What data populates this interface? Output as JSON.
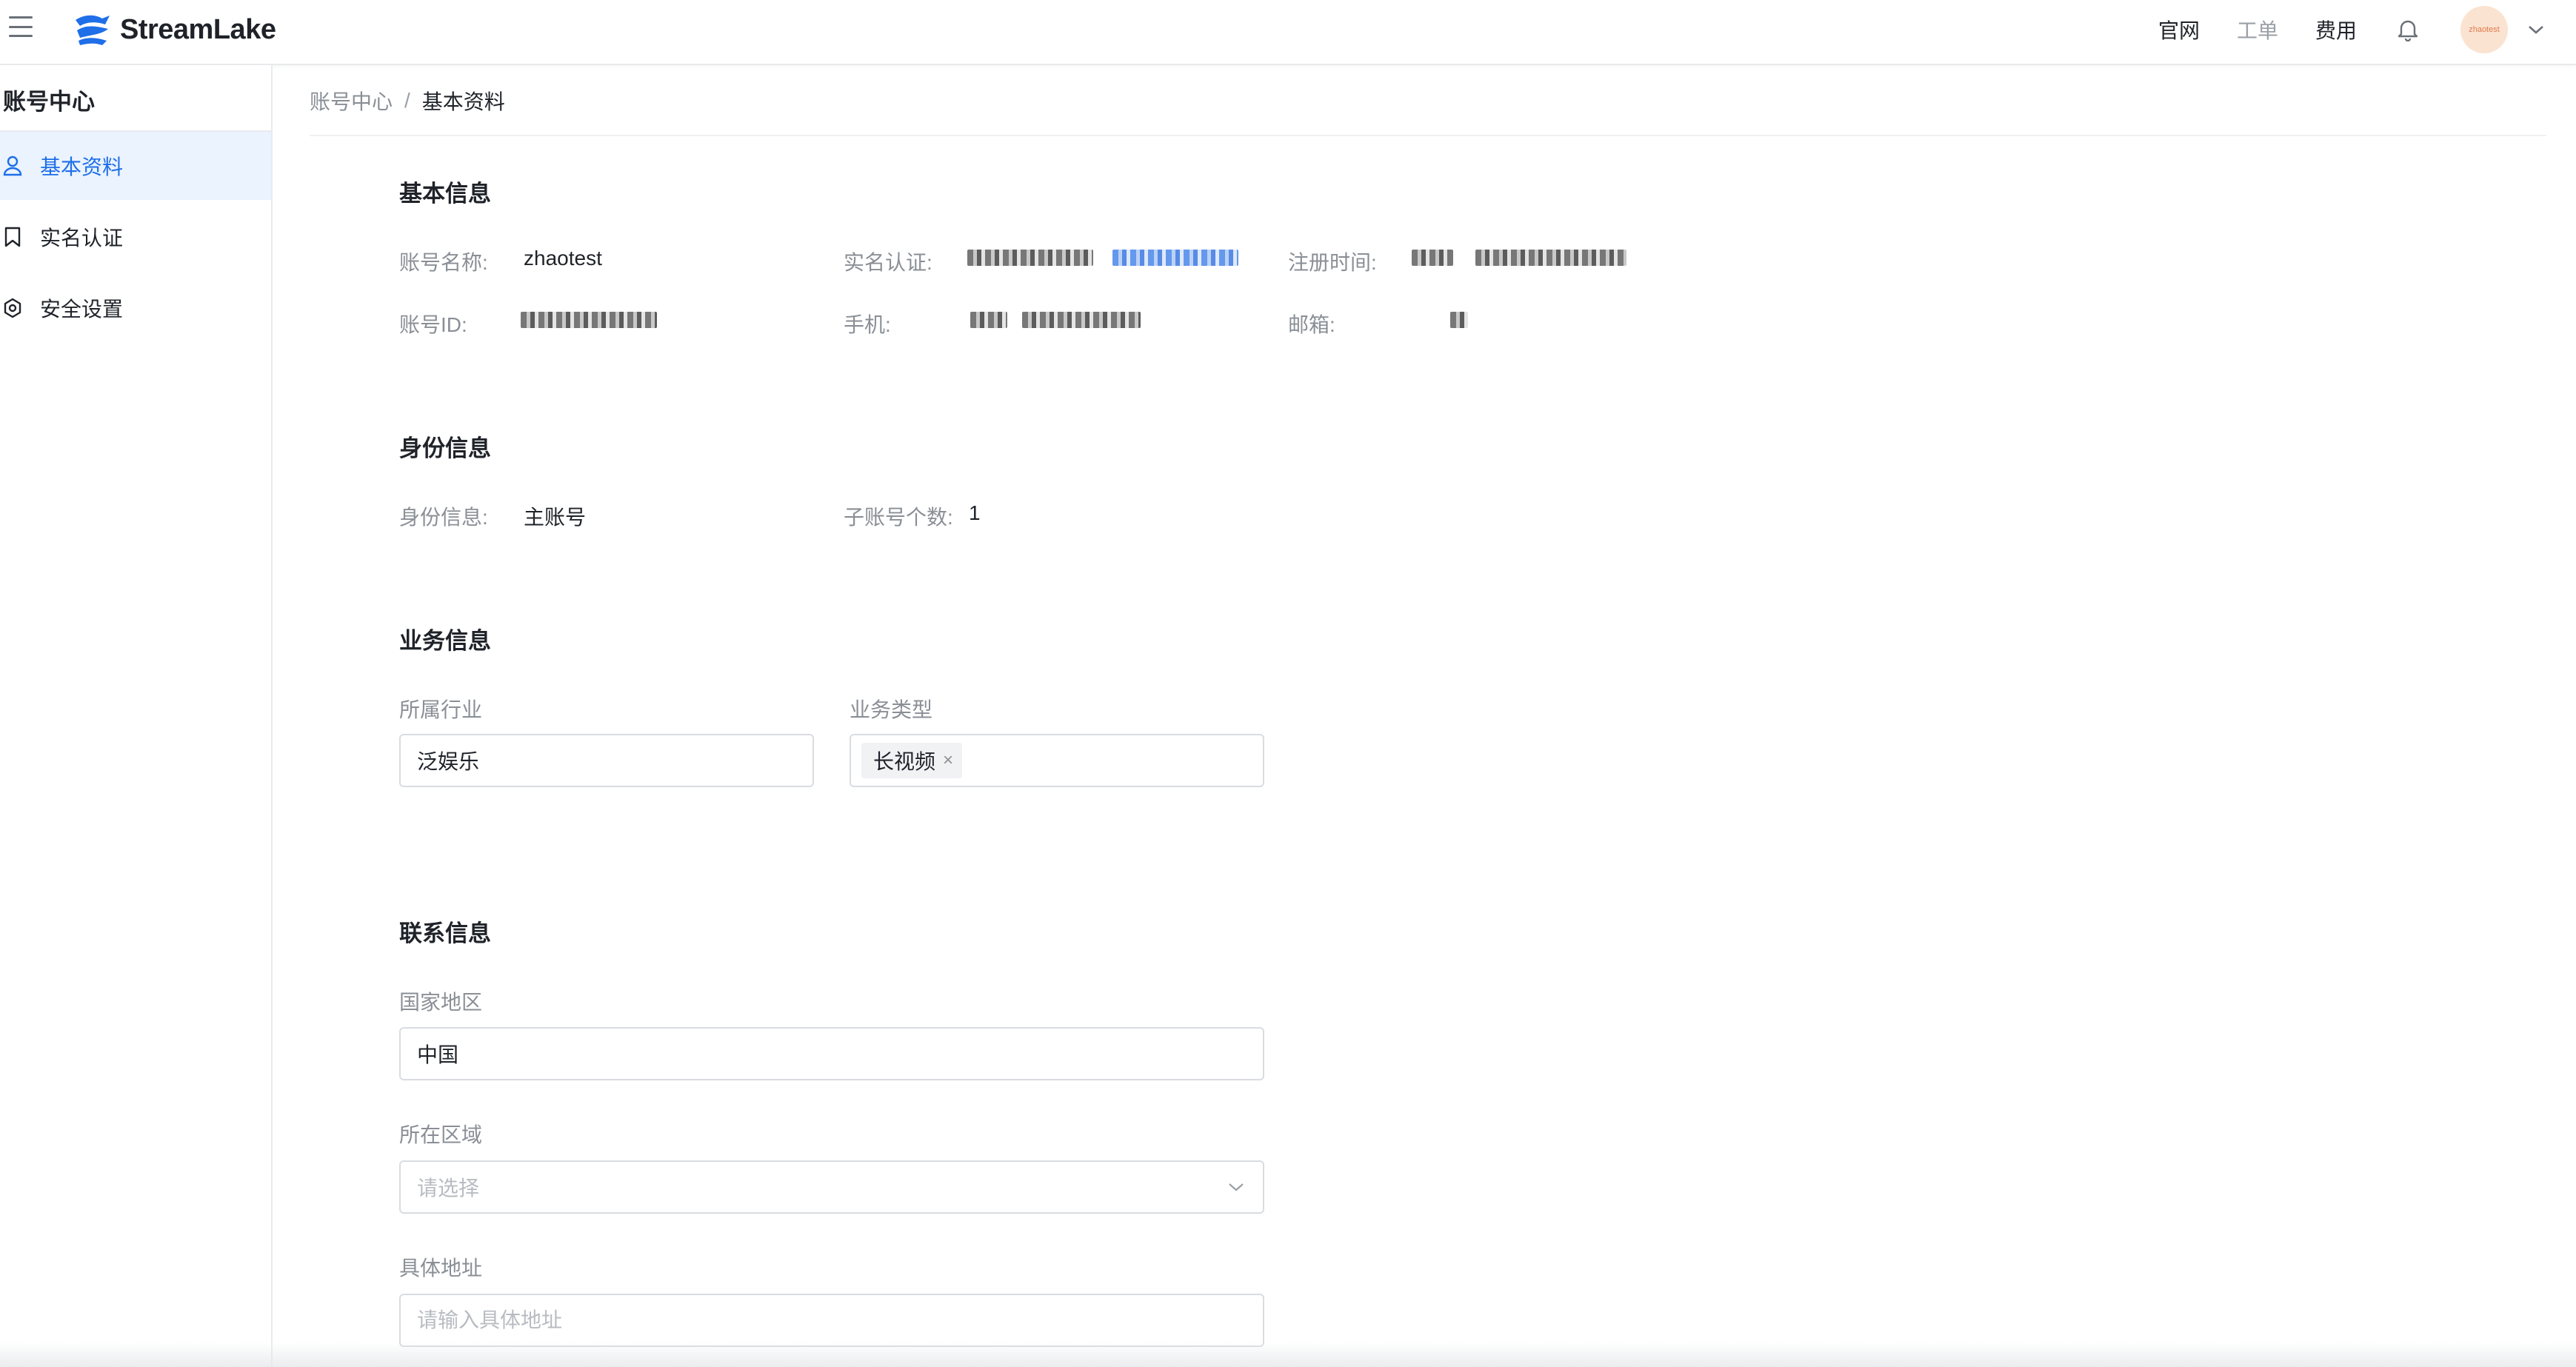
{
  "header": {
    "brand": "StreamLake",
    "nav": {
      "official_site": "官网",
      "tickets": "工单",
      "billing": "费用"
    },
    "avatar_text": "zhaotest"
  },
  "sidebar": {
    "title": "账号中心",
    "items": [
      {
        "label": "基本资料",
        "icon": "user-icon",
        "active": true
      },
      {
        "label": "实名认证",
        "icon": "bookmark-icon",
        "active": false
      },
      {
        "label": "安全设置",
        "icon": "gear-icon",
        "active": false
      }
    ]
  },
  "breadcrumb": {
    "parent": "账号中心",
    "separator": "/",
    "current": "基本资料"
  },
  "basic_info": {
    "title": "基本信息",
    "account_name_label": "账号名称:",
    "account_name_value": "zhaotest",
    "real_name_label": "实名认证:",
    "register_time_label": "注册时间:",
    "account_id_label": "账号ID:",
    "phone_label": "手机:",
    "email_label": "邮箱:"
  },
  "identity_info": {
    "title": "身份信息",
    "identity_label": "身份信息:",
    "identity_value": "主账号",
    "sub_accounts_label": "子账号个数:",
    "sub_accounts_value": "1"
  },
  "business_info": {
    "title": "业务信息",
    "industry_label": "所属行业",
    "industry_value": "泛娱乐",
    "business_type_label": "业务类型",
    "business_type_tags": [
      "长视频"
    ]
  },
  "contact_info": {
    "title": "联系信息",
    "country_label": "国家地区",
    "country_value": "中国",
    "region_label": "所在区域",
    "region_placeholder": "请选择",
    "address_label": "具体地址",
    "address_placeholder": "请输入具体地址"
  },
  "colors": {
    "accent": "#1e6fe8",
    "active_bg": "#eaf3fe",
    "border": "#d9dce0",
    "muted_text": "#8a8f96"
  }
}
